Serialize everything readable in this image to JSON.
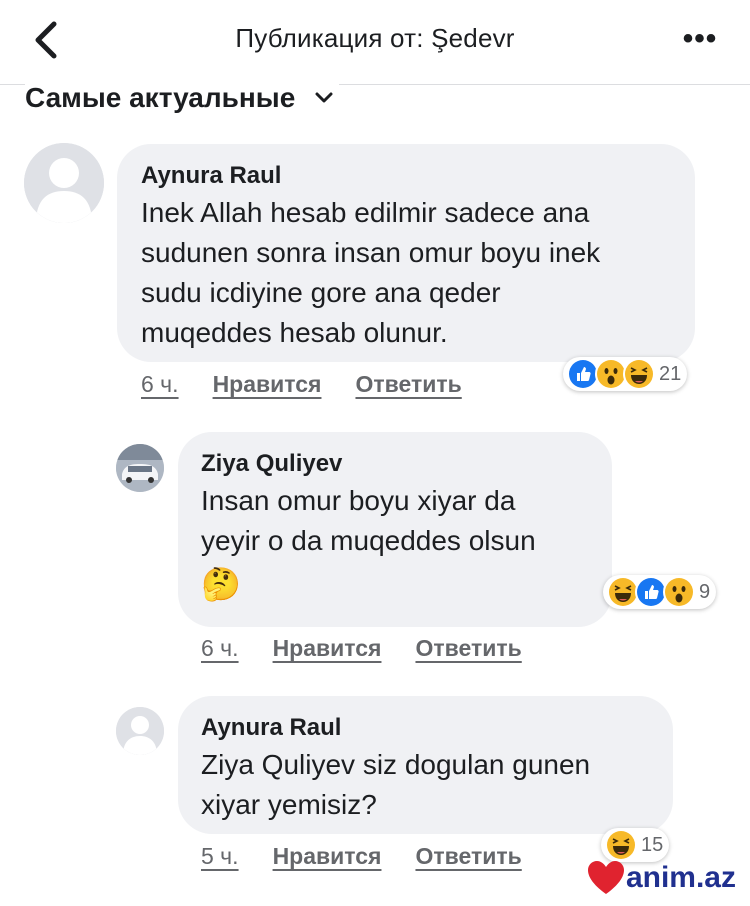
{
  "header": {
    "title": "Публикация от: Şedevr",
    "back_icon": "chevron-left-icon",
    "more_icon": "more-dots-icon",
    "more_label": "•••"
  },
  "sort": {
    "label": "Самые актуальные",
    "icon": "chevron-down-icon"
  },
  "comments": [
    {
      "author": "Aynura Raul",
      "text_lines": [
        "Inek Allah hesab edilmir sadece ana",
        "sudunen sonra insan omur boyu inek",
        "sudu icdiyine gore ana qeder",
        "muqeddes hesab olunur."
      ],
      "time": "6 ч.",
      "like": "Нравится",
      "reply": "Ответить",
      "reactions": [
        "like",
        "wow",
        "haha"
      ],
      "reaction_count": "21"
    },
    {
      "author": "Ziya Quliyev",
      "text_lines": [
        "Insan omur boyu xiyar da",
        "yeyir o da muqeddes olsun"
      ],
      "emoji": "🤔",
      "time": "6 ч.",
      "like": "Нравится",
      "reply": "Ответить",
      "reactions": [
        "haha",
        "like",
        "wow"
      ],
      "reaction_count": "9"
    },
    {
      "author": "Aynura Raul",
      "text_lines": [
        "Ziya Quliyev siz dogulan gunen",
        "xiyar yemisiz?"
      ],
      "time": "5 ч.",
      "like": "Нравится",
      "reply": "Ответить",
      "reactions": [
        "haha"
      ],
      "reaction_count": "15"
    }
  ],
  "watermark": "anim.az",
  "colors": {
    "like_blue": "#1877f2",
    "emoji_yellow": "#f7b928",
    "text": "#1c1e21",
    "meta": "#65676b",
    "bubble": "#f0f1f4"
  }
}
